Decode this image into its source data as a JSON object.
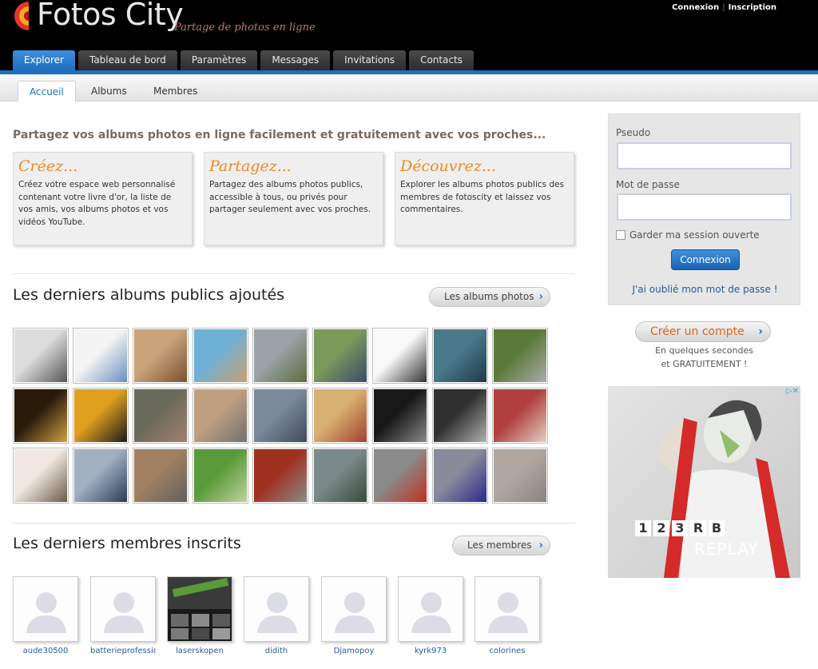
{
  "header": {
    "logo_text": "Fotos City",
    "tagline": "Partage de photos en ligne",
    "login_link": "Connexion",
    "link_sep": "|",
    "signup_link": "Inscription"
  },
  "main_tabs": [
    "Explorer",
    "Tableau de bord",
    "Paramètres",
    "Messages",
    "Invitations",
    "Contacts"
  ],
  "sub_tabs": [
    "Accueil",
    "Albums",
    "Membres"
  ],
  "intro": "Partagez vos albums photos en ligne facilement et gratuitement avec vos proches...",
  "features": [
    {
      "title": "Créez...",
      "text": "Créez votre espace web personnalisé contenant votre livre d'or, la liste de vos amis, vos albums photos et vos vidéos YouTube."
    },
    {
      "title": "Partagez...",
      "text": "Partagez des albums photos publics, accessible à tous, ou privés pour partager seulement avec vos proches."
    },
    {
      "title": "Découvrez...",
      "text": "Explorer les albums photos publics des membres de fotoscity et laissez vos commentaires."
    }
  ],
  "albums": {
    "title": "Les derniers albums publics ajoutés",
    "button": "Les albums photos"
  },
  "members": {
    "title": "Les derniers membres inscrits",
    "button": "Les membres",
    "list": [
      "aude30500",
      "batterieprofessionnelle",
      "laserskopen",
      "didith",
      "Djamopoy",
      "kyrk973",
      "colorines"
    ]
  },
  "login": {
    "pseudo_label": "Pseudo",
    "password_label": "Mot de passe",
    "remember_label": "Garder ma session ouverte",
    "submit": "Connexion",
    "forgot": "J'ai oublié mon mot de passe !"
  },
  "create_account": {
    "button": "Créer un compte",
    "line1": "En quelques secondes",
    "line2": "et GRATUITEMENT !"
  },
  "ad": {
    "logo_chars": [
      "1",
      "2",
      "3",
      "R",
      "B"
    ],
    "replay": "REPLAY",
    "badge": "▷✕"
  },
  "icons": {
    "chevron": "chevron-right-icon",
    "avatar": "person-silhouette-icon"
  },
  "colors": {
    "accent_blue": "#1f6fbe",
    "feature_orange": "#f08a1e",
    "create_orange": "#e0621a"
  }
}
